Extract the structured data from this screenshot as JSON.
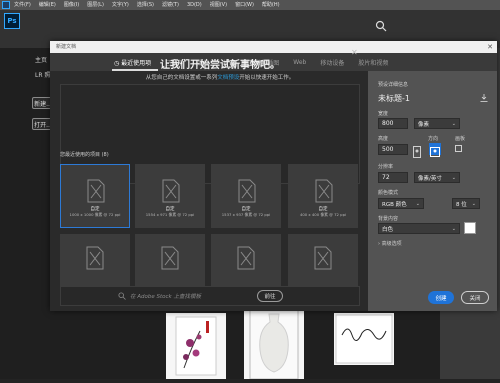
{
  "menubar": {
    "items": [
      "文件(F)",
      "编辑(E)",
      "图像(I)",
      "图层(L)",
      "文字(Y)",
      "选择(S)",
      "滤镜(T)",
      "3D(D)",
      "视图(V)",
      "窗口(W)",
      "帮助(H)"
    ]
  },
  "app": {
    "logo": "Ps",
    "search_icon": "search-icon"
  },
  "home": {
    "sidebar_items": [
      "主页",
      "LR 照..."
    ],
    "buttons": [
      "新建...",
      "打开..."
    ]
  },
  "dialog": {
    "title": "新建文档",
    "tabs": [
      "最近使用项",
      "已保存",
      "照片",
      "打印",
      "图稿和插图",
      "Web",
      "移动设备",
      "胶片和视频"
    ],
    "active_tab": 0,
    "banner": {
      "title": "让我们开始尝试新事物吧。",
      "subtitle_before": "从您自己的文档设置或一系列",
      "subtitle_link": "文档预设",
      "subtitle_after": "开始以快速开始工作。"
    },
    "recent_label": "您最近使用的项目 (8)",
    "cards": [
      {
        "name": "自定",
        "dims": "1000 x 1000 像素 @ 72 ppi"
      },
      {
        "name": "自定",
        "dims": "1554 x 971 像素 @ 72 ppi"
      },
      {
        "name": "自定",
        "dims": "1537 x 937 像素 @ 72 ppi"
      },
      {
        "name": "自定",
        "dims": "400 x 400 像素 @ 72 ppi"
      }
    ],
    "stock_placeholder": "在 Adobe Stock 上查找模板",
    "go_label": "前往",
    "details": {
      "header": "预设详细信息",
      "doc_name": "未标题-1",
      "width_label": "宽度",
      "width_value": "800",
      "width_unit": "像素",
      "height_label": "高度",
      "height_value": "500",
      "orientation_label": "方向",
      "artboard_label": "画板",
      "resolution_label": "分辨率",
      "resolution_value": "72",
      "resolution_unit": "像素/英寸",
      "color_mode_label": "颜色模式",
      "color_mode_value": "RGB 颜色",
      "bit_depth": "8 位",
      "bg_label": "背景内容",
      "bg_value": "白色",
      "advanced_label": "高级选项"
    },
    "create_label": "创建",
    "close_label": "关闭"
  },
  "colors": {
    "accent": "#1f73d8",
    "link": "#2d9cdb"
  }
}
